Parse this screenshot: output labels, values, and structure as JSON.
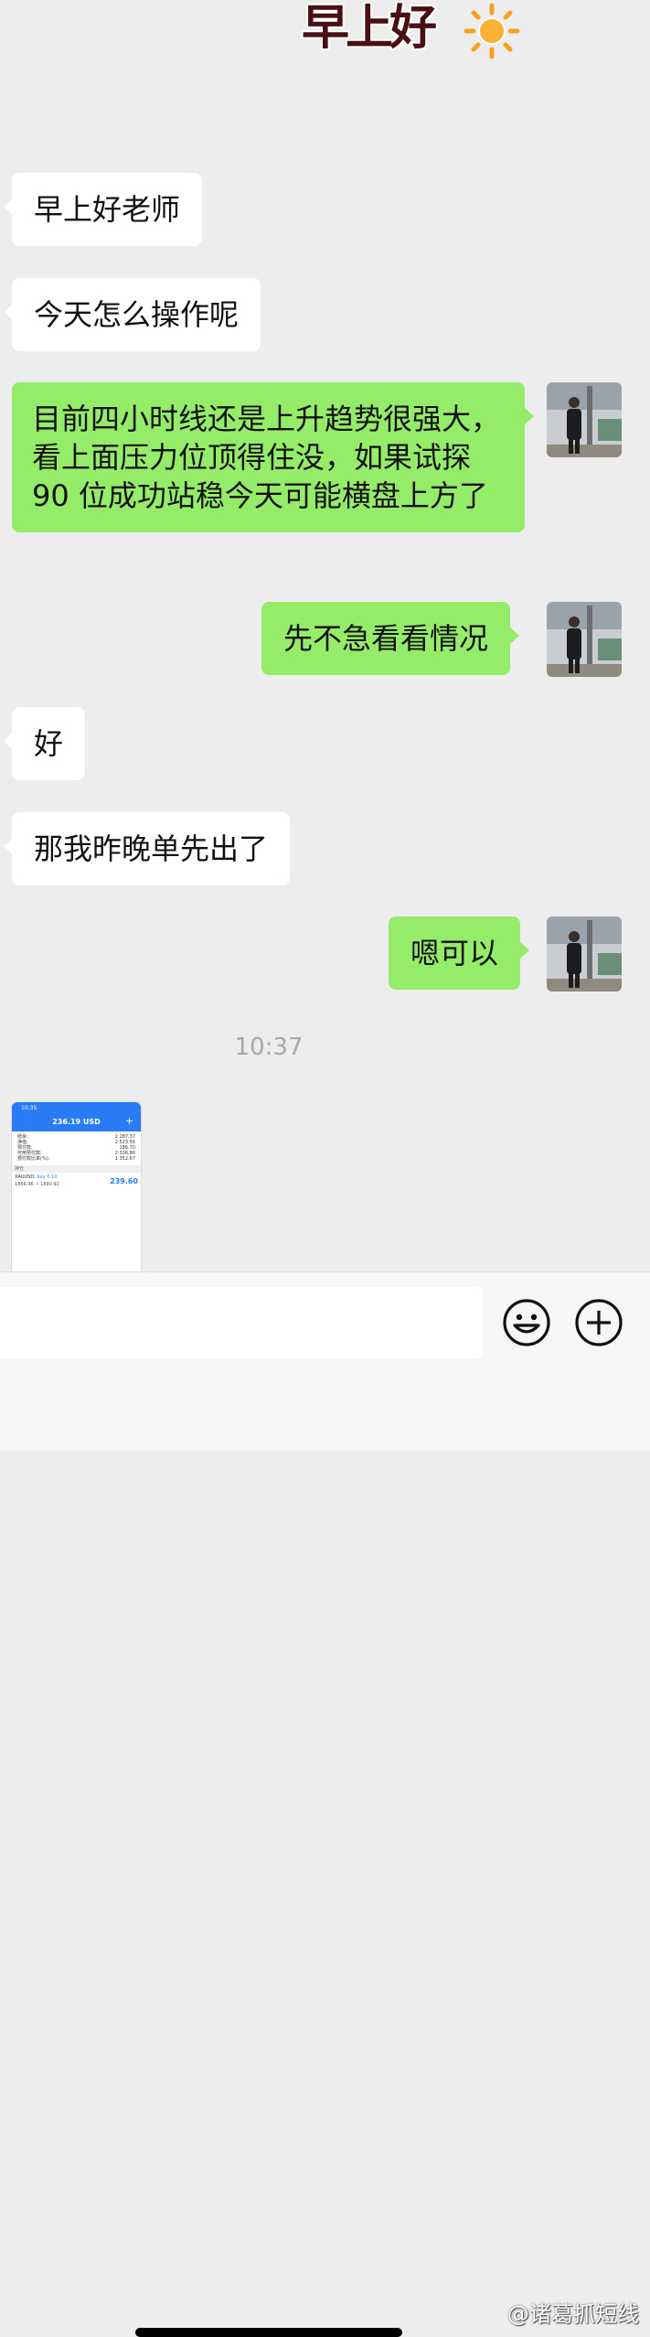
{
  "sticker": {
    "text": "早上好",
    "icon": "sun-icon"
  },
  "messages": [
    {
      "side": "left",
      "text": "早上好老师"
    },
    {
      "side": "left",
      "text": "今天怎么操作呢"
    },
    {
      "side": "right",
      "text": "目前四小时线还是上升趋势很强大，看上面压力位顶得住没，如果试探 90 位成功站稳今天可能横盘上方了"
    },
    {
      "side": "right",
      "text": "先不急看看情况"
    },
    {
      "side": "left",
      "text": "好"
    },
    {
      "side": "left",
      "text": "那我昨晚单先出了"
    },
    {
      "side": "right",
      "text": "嗯可以"
    }
  ],
  "timestamp": "10:37",
  "image_message": {
    "status_time": "10:35",
    "balance": "236.19 USD",
    "rows": [
      {
        "k": "结余:",
        "v": "2 287.37"
      },
      {
        "k": "净值:",
        "v": "2 523.56"
      },
      {
        "k": "预付款:",
        "v": "186.70"
      },
      {
        "k": "可用预付款:",
        "v": "2 336.86"
      },
      {
        "k": "预付款比率(%):",
        "v": "1 352.67"
      }
    ],
    "section": "持仓",
    "position": {
      "symbol": "XAUUSD,",
      "side": "buy 0.10",
      "range": "1866.96 → 1890.92",
      "profit": "239.60"
    }
  },
  "input": {
    "placeholder": ""
  },
  "icons": {
    "emoji": "emoji-icon",
    "plus": "plus-circle-icon"
  },
  "watermark": "@诸葛抓短线"
}
